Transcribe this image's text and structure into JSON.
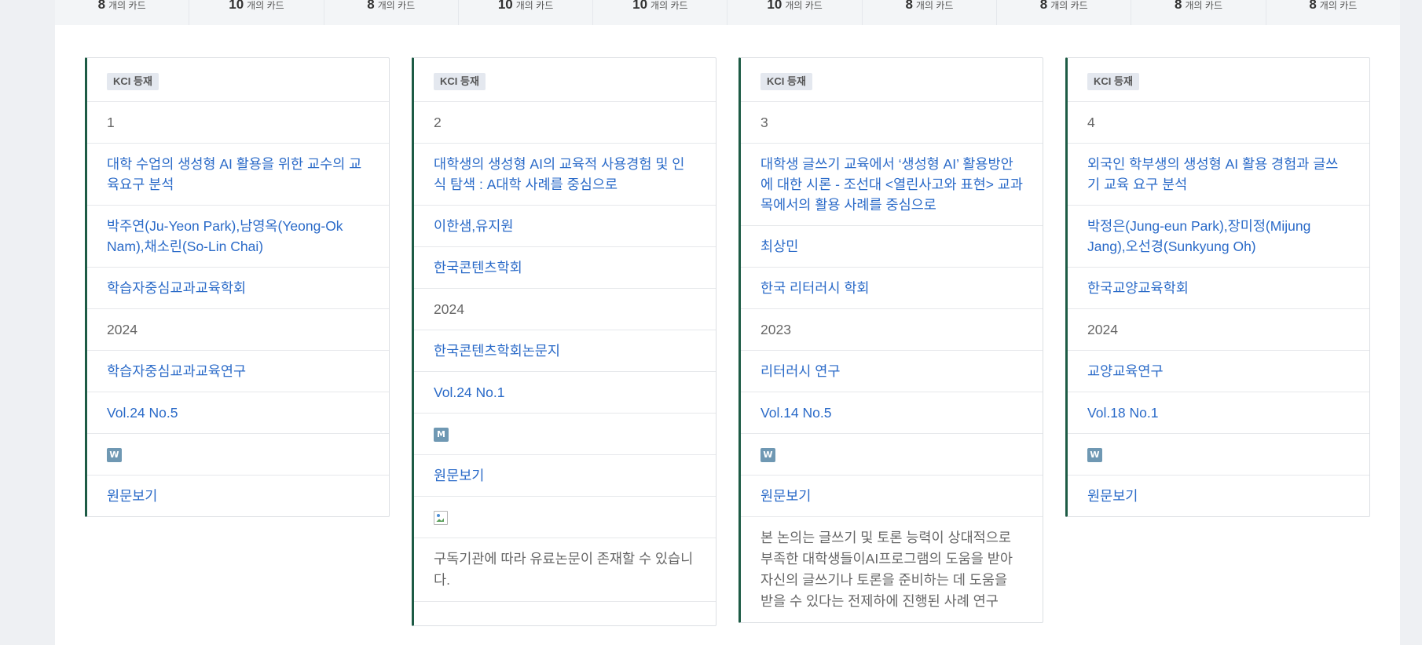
{
  "top_counts": [
    {
      "num": "8",
      "unit": "개의 카드"
    },
    {
      "num": "10",
      "unit": "개의 카드"
    },
    {
      "num": "8",
      "unit": "개의 카드"
    },
    {
      "num": "10",
      "unit": "개의 카드"
    },
    {
      "num": "10",
      "unit": "개의 카드"
    },
    {
      "num": "10",
      "unit": "개의 카드"
    },
    {
      "num": "8",
      "unit": "개의 카드"
    },
    {
      "num": "8",
      "unit": "개의 카드"
    },
    {
      "num": "8",
      "unit": "개의 카드"
    },
    {
      "num": "8",
      "unit": "개의 카드"
    }
  ],
  "cards": [
    {
      "badge": "KCI 등재",
      "index": "1",
      "title": "대학 수업의 생성형 AI 활용을 위한 교수의 교육요구 분석",
      "authors": "박주연(Ju-Yeon Park),남영옥(Yeong-Ok Nam),채소린(So-Lin Chai)",
      "publisher": "학습자중심교과교육학회",
      "year": "2024",
      "journal": "학습자중심교과교육연구",
      "volume": "Vol.24 No.5",
      "icon_letter": "W",
      "view": "원문보기"
    },
    {
      "badge": "KCI 등재",
      "index": "2",
      "title": "대학생의 생성형 AI의 교육적 사용경험 및 인식 탐색 : A대학 사례를 중심으로",
      "authors": "이한샘,유지원",
      "publisher": "한국콘텐츠학회",
      "year": "2024",
      "journal": "한국콘텐츠학회논문지",
      "volume": "Vol.24 No.1",
      "icon_letter": "M",
      "view": "원문보기",
      "note": "구독기관에 따라 유료논문이 존재할 수 있습니다."
    },
    {
      "badge": "KCI 등재",
      "index": "3",
      "title": "대학생 글쓰기 교육에서 ‘생성형 AI’ 활용방안에 대한 시론 - 조선대 <열린사고와 표현> 교과목에서의 활용 사례를 중심으로",
      "authors": "최상민",
      "publisher": "한국 리터러시 학회",
      "year": "2023",
      "journal": "리터러시 연구",
      "volume": "Vol.14 No.5",
      "icon_letter": "W",
      "view": "원문보기",
      "abstract": "본 논의는 글쓰기 및 토론 능력이 상대적으로 부족한 대학생들이AI프로그램의 도움을 받아 자신의 글쓰기나 토론을 준비하는 데 도움을 받을 수 있다는 전제하에 진행된 사례 연구"
    },
    {
      "badge": "KCI 등재",
      "index": "4",
      "title": "외국인 학부생의 생성형 AI 활용 경험과 글쓰기 교육 요구 분석",
      "authors": "박정은(Jung-eun Park),장미정(Mijung Jang),오선경(Sunkyung Oh)",
      "publisher": "한국교양교육학회",
      "year": "2024",
      "journal": "교양교육연구",
      "volume": "Vol.18 No.1",
      "icon_letter": "W",
      "view": "원문보기"
    }
  ]
}
